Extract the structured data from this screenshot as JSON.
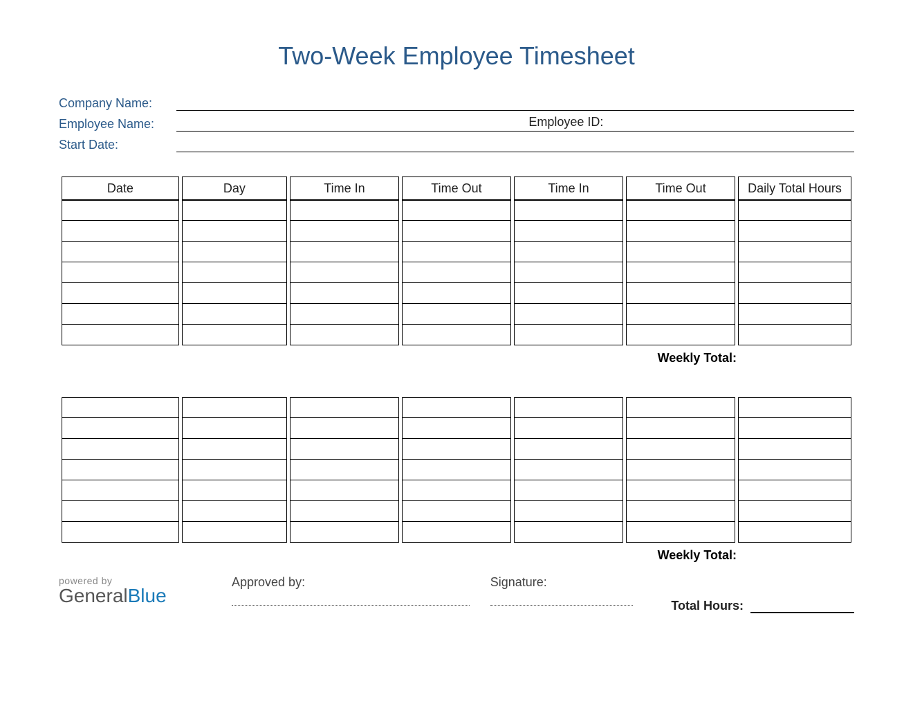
{
  "title": "Two-Week Employee Timesheet",
  "fields": {
    "company_label": "Company Name:",
    "employee_label": "Employee Name:",
    "employee_id_label": "Employee ID:",
    "start_date_label": "Start Date:"
  },
  "columns": [
    "Date",
    "Day",
    "Time In",
    "Time Out",
    "Time In",
    "Time Out",
    "Daily Total Hours"
  ],
  "week1": {
    "rows": 7,
    "weekly_total_label": "Weekly Total:"
  },
  "week2": {
    "rows": 7,
    "weekly_total_label": "Weekly Total:"
  },
  "footer": {
    "powered_small": "powered by",
    "powered_brand_a": "General",
    "powered_brand_b": "Blue",
    "approved_label": "Approved by:",
    "signature_label": "Signature:",
    "total_hours_label": "Total Hours:"
  }
}
